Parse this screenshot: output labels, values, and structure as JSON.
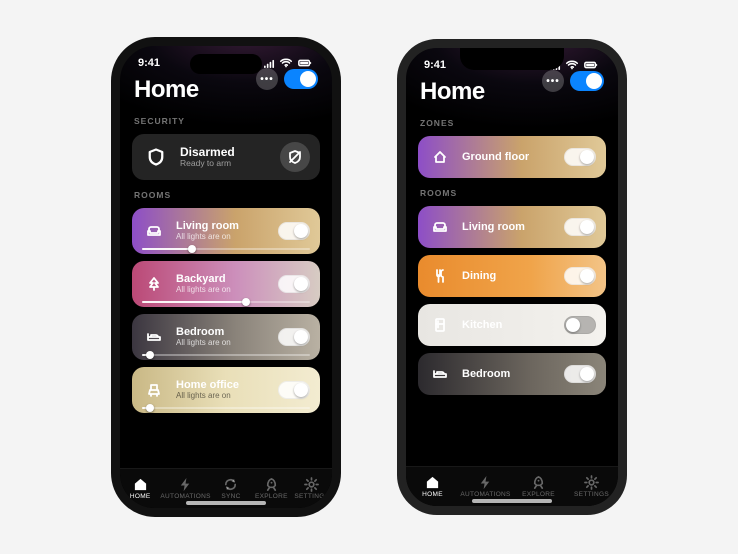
{
  "status": {
    "time": "9:41"
  },
  "header": {
    "title": "Home",
    "master_toggle_on": true
  },
  "phone_left": {
    "sections": {
      "security_label": "SECURITY",
      "rooms_label": "ROOMS"
    },
    "security": {
      "title": "Disarmed",
      "subtitle": "Ready to arm"
    },
    "rooms": [
      {
        "icon": "sofa",
        "name": "Living room",
        "subtitle": "All lights are on",
        "gradient": "g-purple",
        "toggle_on": true,
        "slider": 0.3
      },
      {
        "icon": "tree",
        "name": "Backyard",
        "subtitle": "All lights are on",
        "gradient": "g-pink",
        "toggle_on": true,
        "slider": 0.62
      },
      {
        "icon": "bed",
        "name": "Bedroom",
        "subtitle": "All lights are on",
        "gradient": "g-gray",
        "toggle_on": true,
        "slider": 0.05
      },
      {
        "icon": "chair",
        "name": "Home office",
        "subtitle": "All lights are on",
        "gradient": "g-cream",
        "toggle_on": true,
        "slider": 0.05,
        "dark_text": true
      }
    ]
  },
  "phone_right": {
    "sections": {
      "zones_label": "ZONES",
      "rooms_label": "ROOMS"
    },
    "zones": [
      {
        "icon": "house",
        "name": "Ground floor",
        "gradient": "g-purple",
        "toggle_on": true
      }
    ],
    "rooms": [
      {
        "icon": "sofa",
        "name": "Living room",
        "gradient": "g-purple",
        "toggle_on": true
      },
      {
        "icon": "fork",
        "name": "Dining",
        "gradient": "g-orange",
        "toggle_on": true
      },
      {
        "icon": "fridge",
        "name": "Kitchen",
        "gradient": "g-white",
        "toggle_on": false,
        "dark_text": true
      },
      {
        "icon": "bed",
        "name": "Bedroom",
        "gradient": "g-dark",
        "toggle_on": true
      }
    ]
  },
  "tabbar_left": {
    "items": [
      {
        "icon": "home",
        "label": "HOME",
        "active": true
      },
      {
        "icon": "bolt",
        "label": "AUTOMATIONS",
        "active": false
      },
      {
        "icon": "sync",
        "label": "SYNC",
        "active": false
      },
      {
        "icon": "rocket",
        "label": "EXPLORE",
        "active": false
      },
      {
        "icon": "gear",
        "label": "SETTINGS",
        "active": false
      }
    ]
  },
  "tabbar_right": {
    "items": [
      {
        "icon": "home",
        "label": "HOME",
        "active": true
      },
      {
        "icon": "bolt",
        "label": "AUTOMATIONS",
        "active": false
      },
      {
        "icon": "rocket",
        "label": "EXPLORE",
        "active": false
      },
      {
        "icon": "gear",
        "label": "SETTINGS",
        "active": false
      }
    ]
  }
}
